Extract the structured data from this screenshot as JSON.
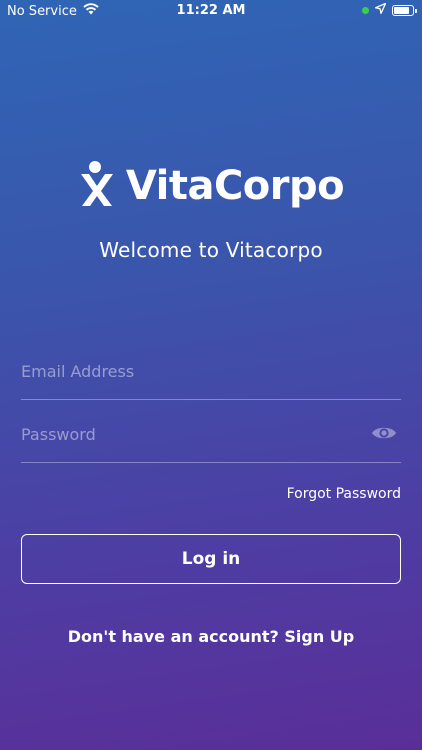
{
  "status_bar": {
    "carrier": "No Service",
    "time": "11:22 AM",
    "battery_level": 0.85,
    "icons": [
      "wifi-icon",
      "location-arrow-icon",
      "battery-icon"
    ]
  },
  "brand": {
    "name": "VitaCorpo",
    "logo_icon": "person-x-logo-icon"
  },
  "welcome_text": "Welcome to Vitacorpo",
  "form": {
    "email_placeholder": "Email Address",
    "password_placeholder": "Password",
    "email_value": "",
    "password_value": "",
    "show_password_icon": "eye-icon",
    "forgot_password": "Forgot Password",
    "login_label": "Log in"
  },
  "signup": {
    "prompt": "Don't have an account?",
    "link": "Sign Up"
  },
  "colors": {
    "gradient_top": "#2f65b5",
    "gradient_bottom": "#5a2e98",
    "text": "#ffffff",
    "status_dot": "#3ad14a"
  }
}
